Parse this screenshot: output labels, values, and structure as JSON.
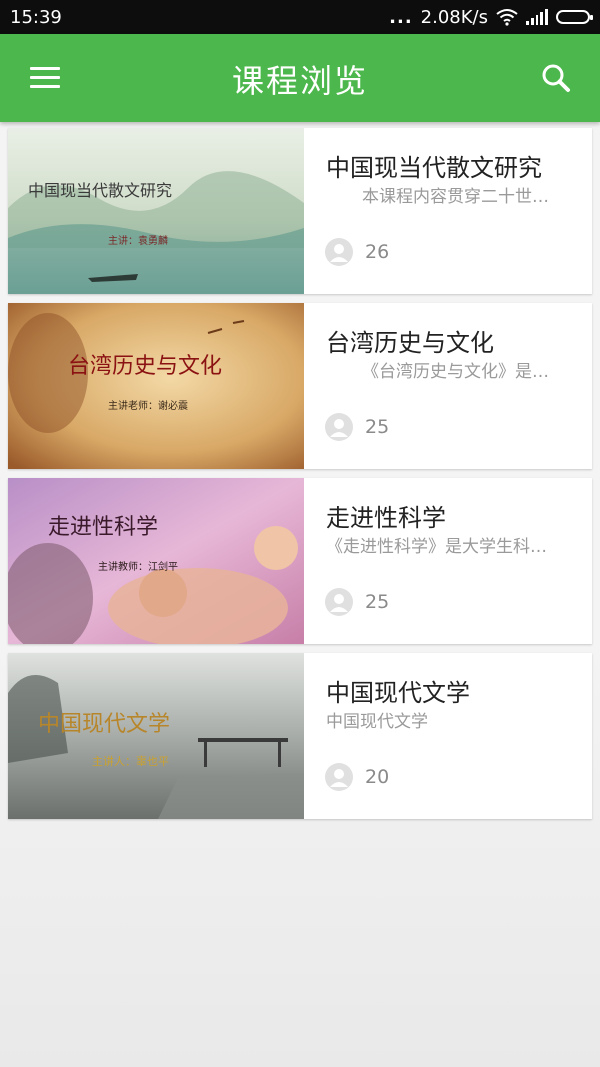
{
  "status": {
    "time": "15:39",
    "dots": "...",
    "speed": "2.08K/s"
  },
  "app_bar": {
    "title": "课程浏览"
  },
  "icons": {
    "menu": "menu-icon",
    "search": "search-icon",
    "avatar": "user-avatar-icon"
  },
  "colors": {
    "accent": "#4cb74c",
    "status_bar": "#0d0d0d"
  },
  "courses": [
    {
      "title": "中国现当代散文研究",
      "description": "本课程内容贯穿二十世纪中国散文",
      "count": "26",
      "thumb_title": "中国现当代散文研究",
      "thumb_sub": "主讲：袁勇麟"
    },
    {
      "title": "台湾历史与文化",
      "description": "《台湾历史与文化》是一门课程",
      "count": "25",
      "thumb_title": "台湾历史与文化",
      "thumb_sub": "主讲老师：谢必震"
    },
    {
      "title": "走进性科学",
      "description": "《走进性科学》是大学生科学课程",
      "count": "25",
      "thumb_title": "走进性科学",
      "thumb_sub": "主讲教师：江剑平"
    },
    {
      "title": "中国现代文学",
      "description": "中国现代文学",
      "count": "20",
      "thumb_title": "中国现代文学",
      "thumb_sub": "主讲人：辜也平"
    }
  ]
}
